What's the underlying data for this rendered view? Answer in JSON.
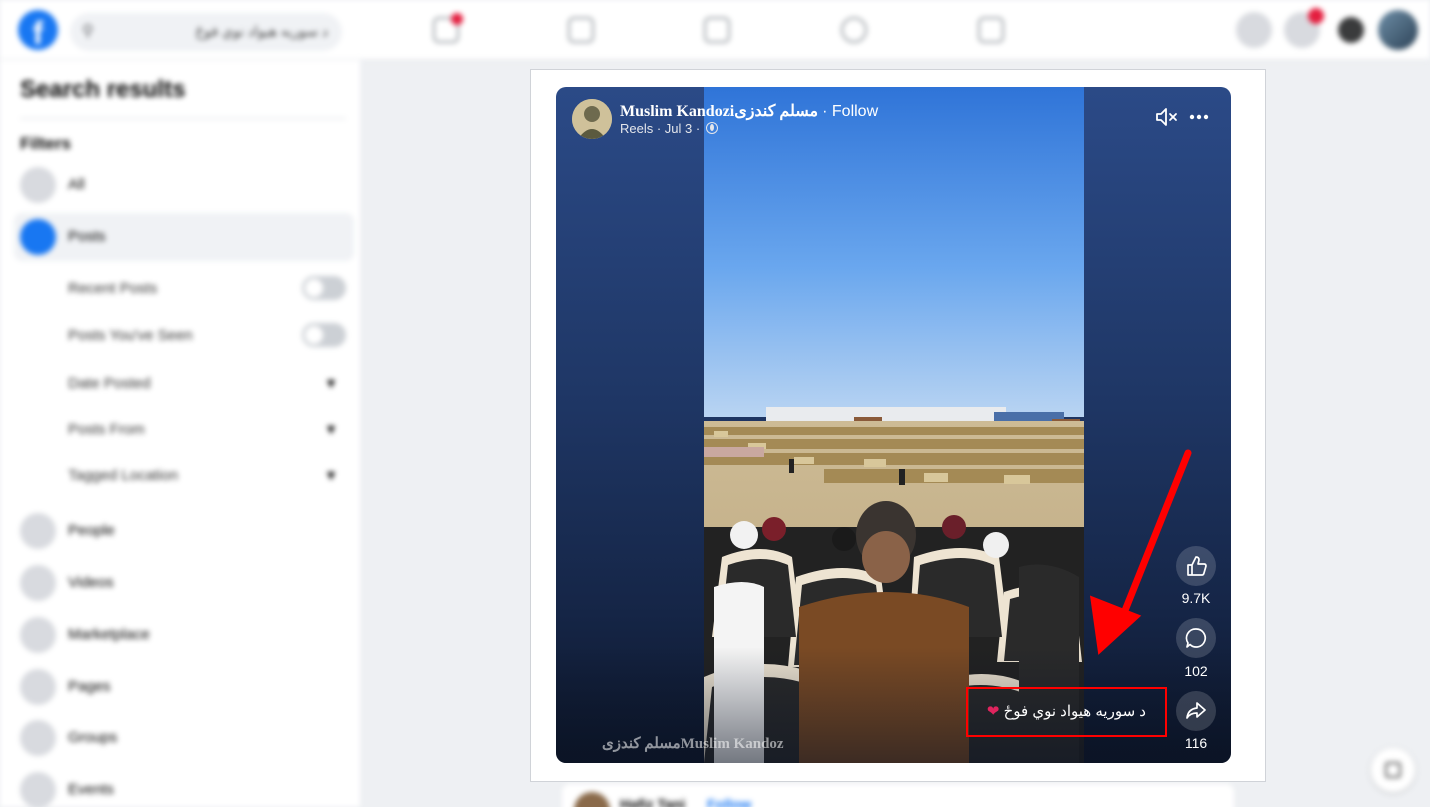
{
  "topbar": {
    "logo": "f",
    "search_value": "د سوريه هيواد نوي فوځ"
  },
  "sidebar": {
    "title": "Search results",
    "filters_label": "Filters",
    "items": [
      {
        "label": "All",
        "icon": "grid-icon"
      },
      {
        "label": "Posts",
        "icon": "posts-icon",
        "active": true
      },
      {
        "label": "People",
        "icon": "people-icon"
      },
      {
        "label": "Videos",
        "icon": "video-icon"
      },
      {
        "label": "Marketplace",
        "icon": "shop-icon"
      },
      {
        "label": "Pages",
        "icon": "flag-icon"
      },
      {
        "label": "Groups",
        "icon": "groups-icon"
      },
      {
        "label": "Events",
        "icon": "calendar-icon"
      }
    ],
    "post_filters": [
      {
        "label": "Recent Posts",
        "type": "toggle",
        "on": false
      },
      {
        "label": "Posts You've Seen",
        "type": "toggle",
        "on": false
      },
      {
        "label": "Date Posted",
        "type": "dropdown"
      },
      {
        "label": "Posts From",
        "type": "dropdown"
      },
      {
        "label": "Tagged Location",
        "type": "dropdown"
      }
    ]
  },
  "reel": {
    "author_latin": "Muslim Kandozi",
    "author_arabic": "مسلم کندزی",
    "follow_label": "· Follow",
    "meta": "Reels · Jul 3 ·",
    "likes": "9.7K",
    "comments": "102",
    "shares": "116",
    "caption": "د سوريه هيواد نوي فوځ",
    "watermark_latin": "Muslim Kandoz",
    "watermark_arabic": "مسلم کندزی"
  },
  "next_post": {
    "name": "Hafiz Tani",
    "follow_label": "Follow"
  },
  "colors": {
    "brand": "#1877f2",
    "highlight": "#ff0000",
    "reel_bg": "#1f3766"
  }
}
